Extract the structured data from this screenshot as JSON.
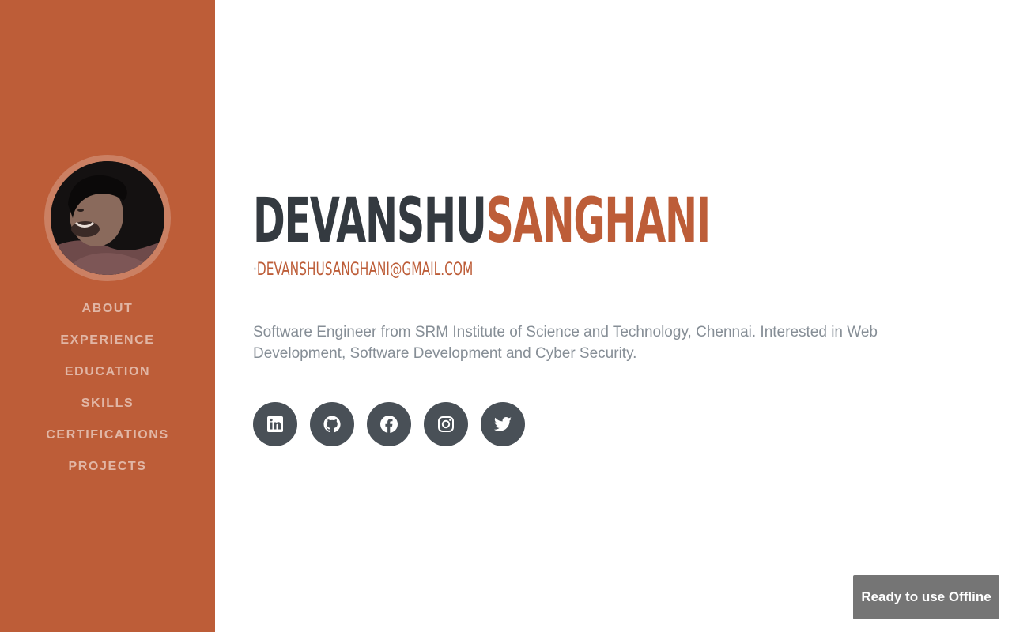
{
  "sidebar": {
    "avatar_alt": "profile photo",
    "nav": [
      {
        "label": "About"
      },
      {
        "label": "Experience"
      },
      {
        "label": "Education"
      },
      {
        "label": "Skills"
      },
      {
        "label": "Certifications"
      },
      {
        "label": "Projects"
      }
    ]
  },
  "about": {
    "first_name": "Devanshu",
    "last_name": "Sanghani",
    "separator": "·",
    "email": "devanshusanghani@gmail.com",
    "lead": "Software Engineer from SRM Institute of Science and Technology, Chennai. Interested in Web Development, Software Development and Cyber Security."
  },
  "social": [
    {
      "icon": "linkedin-icon"
    },
    {
      "icon": "github-icon"
    },
    {
      "icon": "facebook-icon"
    },
    {
      "icon": "instagram-icon"
    },
    {
      "icon": "twitter-icon"
    }
  ],
  "toast": {
    "text": "Ready to use Offline"
  },
  "colors": {
    "primary": "#bd5d38",
    "dark": "#343a40",
    "muted": "#868e96",
    "social_bg": "#495057",
    "toast_bg": "#757575"
  }
}
